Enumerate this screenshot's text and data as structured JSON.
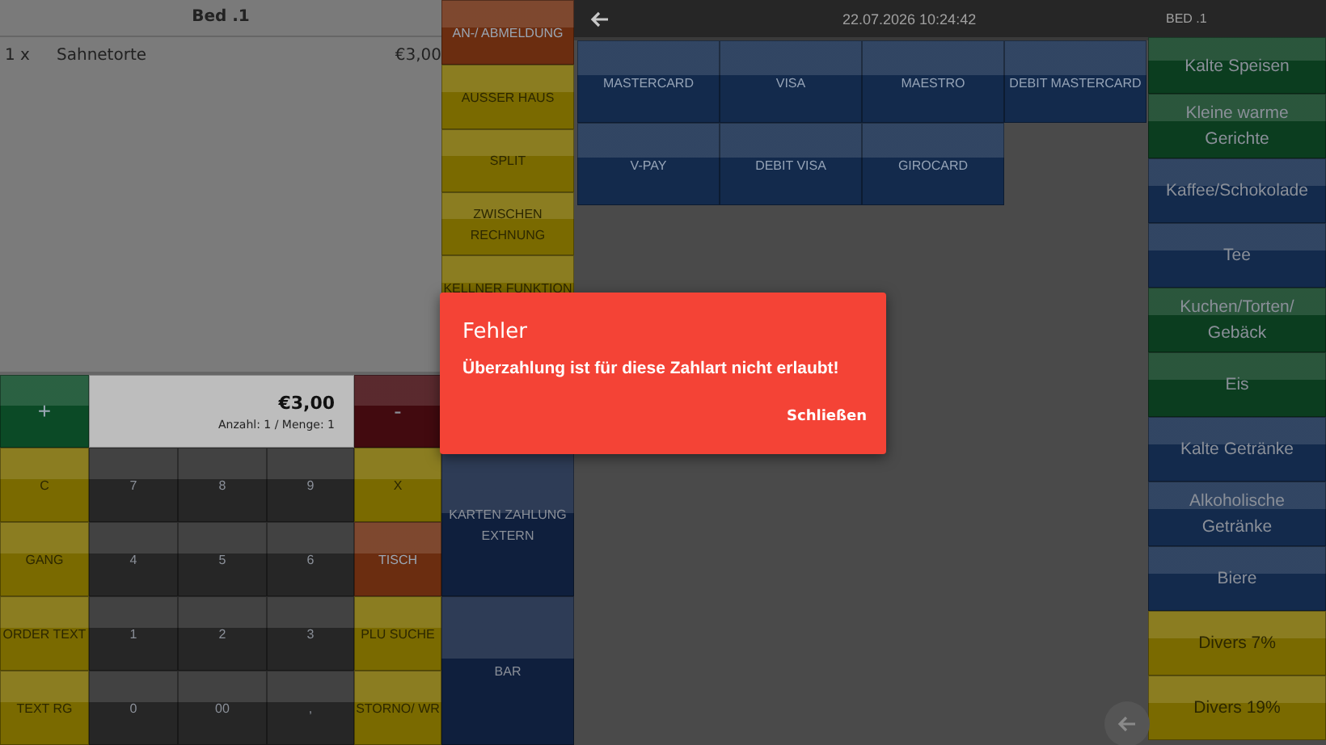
{
  "order": {
    "title": "Bed .1",
    "items": [
      {
        "qty": "1 x",
        "name": "Sahnetorte",
        "price": "€3,00"
      }
    ]
  },
  "summary": {
    "plus": {
      "label": "+",
      "color": "#0b4a26"
    },
    "total": "€3,00",
    "counts": "Anzahl: 1 / Menge: 1",
    "minus": {
      "label": "-",
      "color": "#420a0f"
    }
  },
  "keypad": [
    {
      "label": "C",
      "color": "#7a6a00"
    },
    {
      "label": "7",
      "color": "#262626"
    },
    {
      "label": "8",
      "color": "#262626"
    },
    {
      "label": "9",
      "color": "#262626"
    },
    {
      "label": "X",
      "color": "#7a6a00"
    },
    {
      "label": "GANG",
      "color": "#7a6a00"
    },
    {
      "label": "4",
      "color": "#262626"
    },
    {
      "label": "5",
      "color": "#262626"
    },
    {
      "label": "6",
      "color": "#262626"
    },
    {
      "label": "TISCH",
      "color": "#6b2d10"
    },
    {
      "label": "ORDER TEXT",
      "color": "#7a6a00"
    },
    {
      "label": "1",
      "color": "#262626"
    },
    {
      "label": "2",
      "color": "#262626"
    },
    {
      "label": "3",
      "color": "#262626"
    },
    {
      "label": "PLU SUCHE",
      "color": "#7a6a00"
    },
    {
      "label": "TEXT RG",
      "color": "#7a6a00"
    },
    {
      "label": "0",
      "color": "#262626"
    },
    {
      "label": "00",
      "color": "#262626"
    },
    {
      "label": ",",
      "color": "#262626"
    },
    {
      "label": "STORNO/ WR",
      "color": "#7a6a00"
    }
  ],
  "functions": [
    {
      "label": "AN-/ ABMELDUNG",
      "color": "#6b2d10"
    },
    {
      "label": "AUSSER HAUS",
      "color": "#7a6a00"
    },
    {
      "label": "SPLIT",
      "color": "#7a6a00"
    },
    {
      "label": "ZWISCHEN RECHNUNG",
      "color": "#7a6a00"
    },
    {
      "label": "KELLNER FUNKTION",
      "color": "#7a6a00"
    },
    {
      "label": "KARTEN ZAHLUNG EXTERN",
      "color": "#0f1f3d"
    },
    {
      "label": "BAR",
      "color": "#0f1f3d"
    }
  ],
  "topbar": {
    "datetime": "22.07.2026 10:24:42",
    "table": "BED .1"
  },
  "payments": [
    {
      "label": "MASTERCARD"
    },
    {
      "label": "VISA"
    },
    {
      "label": "MAESTRO"
    },
    {
      "label": "DEBIT MASTERCARD"
    },
    {
      "label": "V-PAY"
    },
    {
      "label": "DEBIT VISA"
    },
    {
      "label": "GIROCARD"
    }
  ],
  "categories": [
    {
      "label": "Kalte Speisen",
      "color": "#0b3d1f"
    },
    {
      "label": "Kleine warme Gerichte",
      "color": "#0b3d1f"
    },
    {
      "label": "Kaffee/Schokolade",
      "color": "#132a4c"
    },
    {
      "label": "Tee",
      "color": "#132a4c"
    },
    {
      "label": "Kuchen/Torten/ Gebäck",
      "color": "#0b3d1f"
    },
    {
      "label": "Eis",
      "color": "#0b3d1f"
    },
    {
      "label": "Kalte Getränke",
      "color": "#132a4c"
    },
    {
      "label": "Alkoholische Getränke",
      "color": "#132a4c"
    },
    {
      "label": "Biere",
      "color": "#132a4c"
    },
    {
      "label": "Divers 7%",
      "color": "#7a6a00"
    },
    {
      "label": "Divers 19%",
      "color": "#7a6a00"
    }
  ],
  "dialog": {
    "title": "Fehler",
    "message": "Überzahlung ist für diese Zahlart nicht erlaubt!",
    "button": "Schließen"
  }
}
